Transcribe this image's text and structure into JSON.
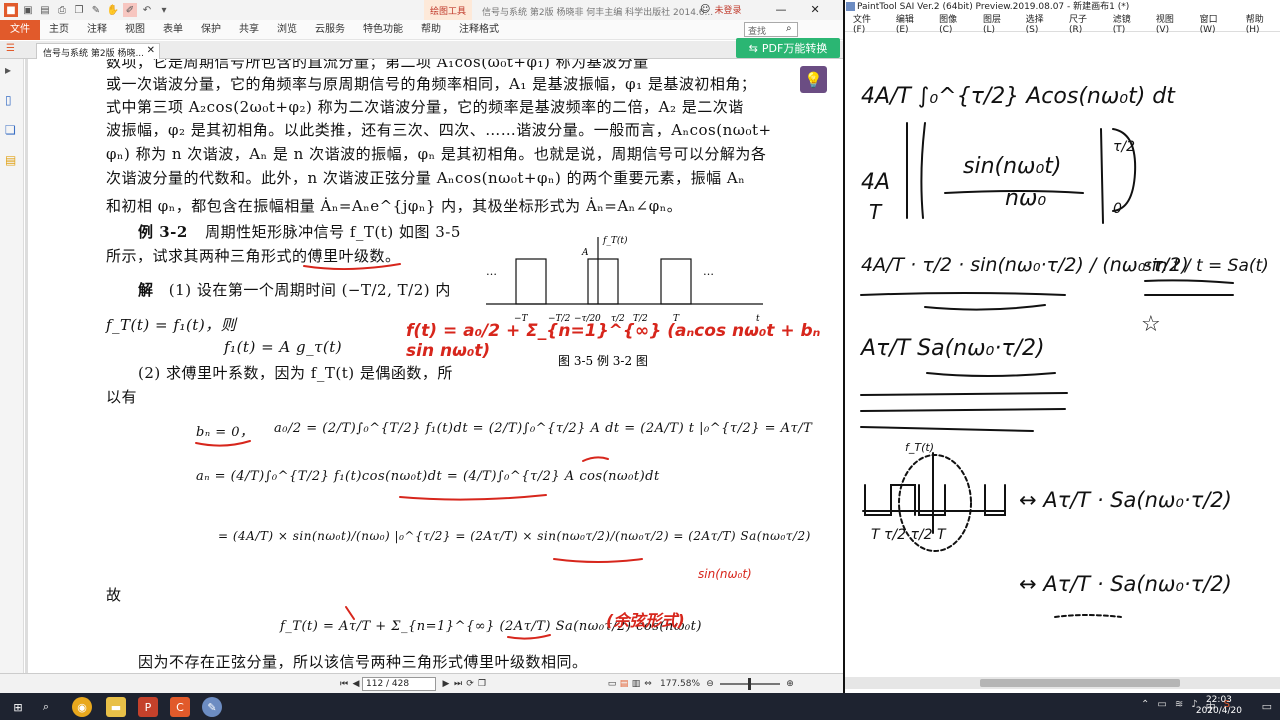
{
  "pdf": {
    "doc_title": "信号与系统  第2版 杨晓非  何丰主编  科学出版社  2014.6...",
    "context_tab": "绘图工具",
    "login": "未登录",
    "search_placeholder": "查找",
    "menus": [
      "文件",
      "主页",
      "注释",
      "视图",
      "表单",
      "保护",
      "共享",
      "浏览",
      "云服务",
      "特色功能",
      "帮助",
      "注释格式"
    ],
    "tab_label": "信号与系统  第2版 杨晓...",
    "convert_label": "PDF万能转换",
    "page_indicator": "112 / 428",
    "zoom": "177.58%",
    "body": {
      "line1": "数项，它是周期信号所包含的直流分量；第二项 A₁cos(ω₀t+φ₁) 称为基波分量",
      "line2": "或一次谐波分量，它的角频率与原周期信号的角频率相同，A₁ 是基波振幅，φ₁ 是基波初相角；",
      "line3": "式中第三项 A₂cos(2ω₀t+φ₂) 称为二次谐波分量，它的频率是基波频率的二倍，A₂ 是二次谐",
      "line4": "波振幅，φ₂ 是其初相角。以此类推，还有三次、四次、……谐波分量。一般而言，Aₙcos(nω₀t+",
      "line5": "φₙ) 称为 n 次谐波，Aₙ 是 n 次谐波的振幅，φₙ 是其初相角。也就是说，周期信号可以分解为各",
      "line6": "次谐波分量的代数和。此外，n 次谐波正弦分量 Aₙcos(nω₀t+φₙ) 的两个重要元素，振幅 Aₙ",
      "line7": "和初相 φₙ，都包含在振幅相量 Ȧₙ=Aₙe^{jφₙ} 内，其极坐标形式为 Ȧₙ=Aₙ∠φₙ。",
      "example_label": "例 3-2",
      "example_text": "周期性矩形脉冲信号 f_T(t) 如图 3-5",
      "line9": "所示，试求其两种三角形式的傅里叶级数。",
      "solution_label": "解",
      "step1": "(1) 设在第一个周期时间 (−T/2, T/2) 内",
      "eq1": "f_T(t) = f₁(t)，则",
      "eq2": "f₁(t) = A g_τ(t)",
      "step2": "(2) 求傅里叶系数，因为 f_T(t) 是偶函数，所",
      "line_youyou": "以有",
      "bn": "bₙ = 0，",
      "a0": "a₀/2 = (2/T)∫₀^{T/2} f₁(t)dt = (2/T)∫₀^{τ/2} A dt = (2A/T) t |₀^{τ/2} = Aτ/T",
      "an1": "aₙ = (4/T)∫₀^{T/2} f₁(t)cos(nω₀t)dt = (4/T)∫₀^{τ/2} A cos(nω₀t)dt",
      "an2": "= (4A/T) × sin(nω₀t)/(nω₀) |₀^{τ/2} = (2Aτ/T) × sin(nω₀τ/2)/(nω₀τ/2) = (2Aτ/T) Sa(nω₀τ/2)",
      "therefore": "故",
      "series": "f_T(t) = Aτ/T + Σ_{n=1}^{∞} (2Aτ/T) Sa(nω₀τ/2) cos(nω₀t)",
      "conclusion": "因为不存在正弦分量，所以该信号两种三角形式傅里叶级数相同。",
      "figure_caption": "图 3-5   例 3-2 图",
      "figure_ylabel": "f_T(t)",
      "figure_amp": "A",
      "figure_xticks": [
        "−T",
        "−T/2",
        "−τ/2",
        "0",
        "τ/2",
        "T/2",
        "T",
        "t"
      ],
      "figure_dots": "…"
    },
    "annotations": {
      "fourier_series": "f(t) = a₀/2 + Σ_{n=1}^{∞} (aₙcos nω₀t + bₙ sin nω₀t)",
      "sin_note": "sin(nω₀t)",
      "chinese_note": "(余弦形式)"
    }
  },
  "sai": {
    "title": "PaintTool SAI Ver.2 (64bit) Preview.2019.08.07 - 新建画布1 (*)",
    "menus": [
      "文件(F)",
      "编辑(E)",
      "图像(C)",
      "图层(L)",
      "选择(S)",
      "尺子(R)",
      "滤镜(T)",
      "视图(V)",
      "窗口(W)",
      "帮助(H)"
    ],
    "ink": {
      "l1": "4A/T ∫₀^{τ/2} Acos(nω₀t) dt",
      "l2a": "4A",
      "l2b": "T",
      "l2c": "sin(nω₀t)",
      "l2d": "nω₀",
      "l2e": "τ/2",
      "l2f": "0",
      "l3": "4A/T · τ/2 · sin(nω₀·τ/2) / (nω₀·τ/2)",
      "side": "sin t / t = Sa(t)",
      "l4": "Aτ/T  Sa(nω₀·τ/2)",
      "sketch_label": "f_T(t)",
      "sketch_ticks": "T  τ/2  τ/2  T",
      "r1": "↔  Aτ/T · Sa(nω₀·τ/2)",
      "r2": "↔  Aτ/T · Sa(nω₀·τ/2)"
    }
  },
  "taskbar": {
    "time": "22:03",
    "date": "2020/4/20",
    "ime": "中"
  }
}
